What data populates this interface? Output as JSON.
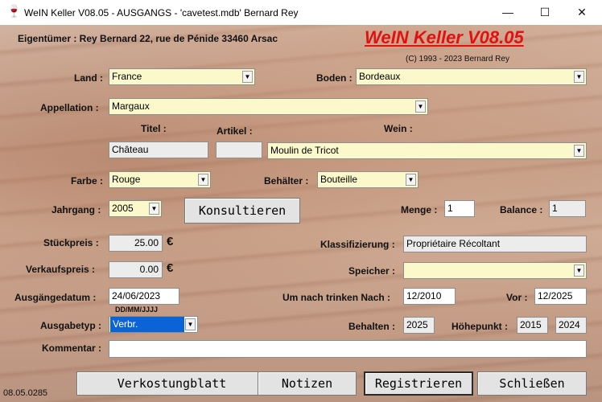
{
  "window": {
    "title": "WeIN Keller V08.05 - AUSGANGS -  'cavetest.mdb'   Bernard Rey",
    "app_icon": "wine-glass-icon"
  },
  "header": {
    "owner": "Eigentümer : Rey Bernard 22, rue de Pénide 33460 Arsac",
    "brand": "WeIN Keller V08.05",
    "copyright": "(C) 1993 - 2023 Bernard Rey"
  },
  "labels": {
    "land": "Land :",
    "boden": "Boden :",
    "appellation": "Appellation :",
    "titel": "Titel :",
    "artikel": "Artikel :",
    "wein": "Wein :",
    "farbe": "Farbe :",
    "behaelter": "Behälter :",
    "jahrgang": "Jahrgang :",
    "menge": "Menge :",
    "balance": "Balance :",
    "stueckpreis": "Stückpreis :",
    "klassifizierung": "Klassifizierung :",
    "verkaufspreis": "Verkaufspreis :",
    "speicher": "Speicher :",
    "ausgangsdatum": "Ausgängedatum :",
    "um_nach_trinken": "Um nach trinken Nach :",
    "vor": "Vor :",
    "date_format": "DD/MM/JJJJ",
    "ausgabetyp": "Ausgabetyp :",
    "behalten": "Behalten :",
    "hoehepunkt": "Höhepunkt :",
    "kommentar": "Kommentar :",
    "currency": "€"
  },
  "fields": {
    "land": "France",
    "boden": "Bordeaux",
    "appellation": "Margaux",
    "titel": "Château",
    "artikel": "",
    "wein": "Moulin de Tricot",
    "farbe": "Rouge",
    "behaelter": "Bouteille",
    "jahrgang": "2005",
    "menge": "1",
    "balance": "1",
    "stueckpreis": "25.00",
    "klassifizierung": "Propriétaire Récoltant",
    "verkaufspreis": "0.00",
    "speicher": "",
    "ausgangsdatum": "24/06/2023",
    "um_nach_trinken": "12/2010",
    "vor": "12/2025",
    "ausgabetyp": "Verbr.",
    "behalten": "2025",
    "hoehepunkt_from": "2015",
    "hoehepunkt_to": "2024",
    "kommentar": ""
  },
  "buttons": {
    "konsultieren": "Konsultieren",
    "verkostungsblatt": "Verkostungblatt",
    "notizen": "Notizen",
    "registrieren": "Registrieren",
    "schliessen": "Schließen"
  },
  "status": {
    "date": "08.05.0285"
  }
}
